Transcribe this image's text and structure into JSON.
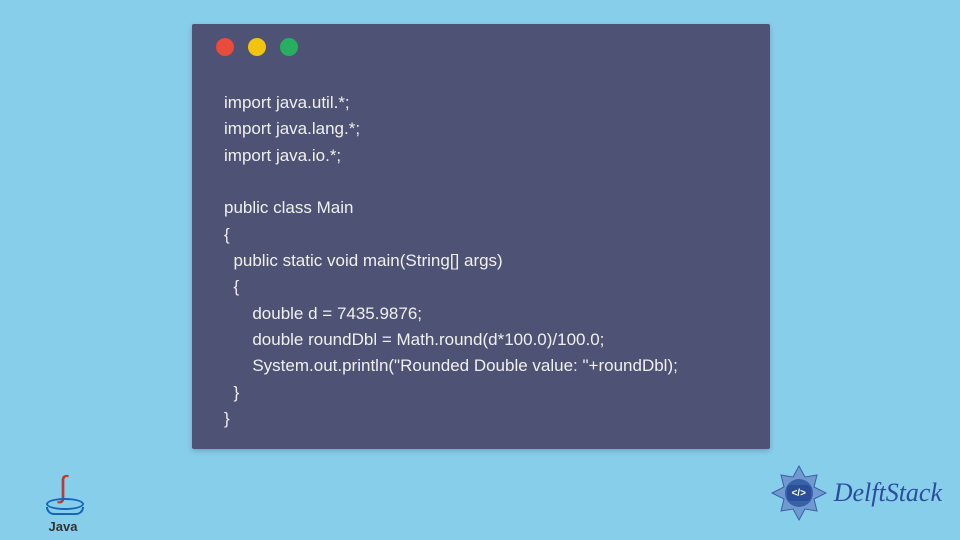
{
  "code_lines": [
    "import java.util.*;",
    "import java.lang.*;",
    "import java.io.*;",
    "",
    "public class Main",
    "{",
    "  public static void main(String[] args)",
    "  {",
    "      double d = 7435.9876;",
    "      double roundDbl = Math.round(d*100.0)/100.0;",
    "      System.out.println(\"Rounded Double value: \"+roundDbl);",
    "  }",
    "}"
  ],
  "java_label": "Java",
  "delft_label": "DelftStack",
  "delft_tag": "</>"
}
